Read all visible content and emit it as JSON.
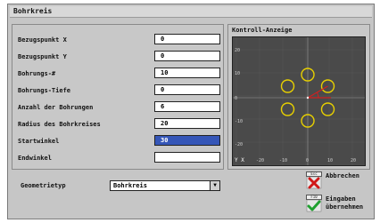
{
  "window": {
    "title": "Bohrkreis"
  },
  "form": {
    "fields": [
      {
        "label": "Bezugspunkt X",
        "value": "0",
        "selected": false
      },
      {
        "label": "Bezugspunkt Y",
        "value": "0",
        "selected": false
      },
      {
        "label": "Bohrungs-#",
        "value": "10",
        "selected": false
      },
      {
        "label": "Bohrungs-Tiefe",
        "value": "0",
        "selected": false
      },
      {
        "label": "Anzahl der Bohrungen",
        "value": "6",
        "selected": false
      },
      {
        "label": "Radius des Bohrkreises",
        "value": "20",
        "selected": false
      },
      {
        "label": "Startwinkel",
        "value": "30",
        "selected": true
      },
      {
        "label": "Endwinkel",
        "value": "",
        "selected": false
      }
    ]
  },
  "control": {
    "title": "Kontroll-Anzeige",
    "y_ticks": [
      "20",
      "10",
      "0",
      "-10",
      "-20"
    ],
    "x_ticks": [
      "-20",
      "-10",
      "0",
      "10",
      "20"
    ],
    "axis_label": "Y X",
    "holes": 6,
    "radius": 20,
    "start_angle_deg": 30,
    "hole_color": "#e8d000",
    "angle_color": "#d02020"
  },
  "geometry": {
    "label": "Geometrietyp",
    "selected": "Bohrkreis"
  },
  "buttons": {
    "cancel": {
      "key": "Esc",
      "label": "Abbrechen"
    },
    "accept": {
      "key": "F10",
      "label": "Eingaben\nübernehmen"
    }
  }
}
